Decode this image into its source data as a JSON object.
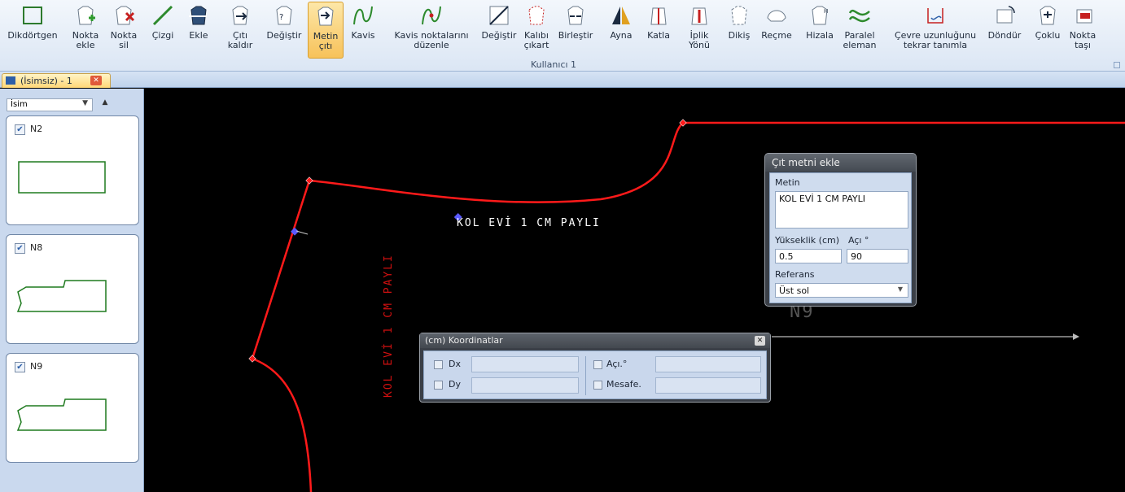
{
  "ribbon": {
    "tools": [
      {
        "id": "dikdortgen",
        "label": "Dikdörtgen",
        "icon": "rectangle-icon"
      },
      {
        "id": "nokta-ekle",
        "label": "Nokta ekle",
        "icon": "add-point-icon"
      },
      {
        "id": "nokta-sil",
        "label": "Nokta sil",
        "icon": "delete-point-icon"
      },
      {
        "id": "cizgi",
        "label": "Çizgi",
        "icon": "line-icon"
      },
      {
        "id": "ekle",
        "label": "Ekle",
        "icon": "insert-icon"
      },
      {
        "id": "citi-kaldir",
        "label": "Çıtı kaldır",
        "icon": "remove-notch-icon"
      },
      {
        "id": "degistir-1",
        "label": "Değiştir",
        "icon": "change-icon"
      },
      {
        "id": "metin-citi",
        "label": "Metin çıtı",
        "icon": "text-notch-icon",
        "active": true
      },
      {
        "id": "kavis",
        "label": "Kavis",
        "icon": "curve-icon"
      },
      {
        "id": "kavis-noktalari",
        "label": "Kavis noktalarını düzenle",
        "icon": "edit-curve-points-icon"
      },
      {
        "id": "degistir-2",
        "label": "Değiştir",
        "icon": "replace-icon"
      },
      {
        "id": "kalibi-cikart",
        "label": "Kalıbı çıkart",
        "icon": "extract-pattern-icon"
      },
      {
        "id": "birlestir",
        "label": "Birleştir",
        "icon": "merge-icon"
      },
      {
        "id": "ayna",
        "label": "Ayna",
        "icon": "mirror-icon"
      },
      {
        "id": "katla",
        "label": "Katla",
        "icon": "fold-icon"
      },
      {
        "id": "iplik-yonu",
        "label": "İplik Yönü",
        "icon": "grain-line-icon"
      },
      {
        "id": "dikis",
        "label": "Dikiş",
        "icon": "seam-icon"
      },
      {
        "id": "recme",
        "label": "Reçme",
        "icon": "gather-icon"
      },
      {
        "id": "hizala",
        "label": "Hizala",
        "icon": "align-icon"
      },
      {
        "id": "paralel-eleman",
        "label": "Paralel eleman",
        "icon": "parallel-icon"
      },
      {
        "id": "cevre-uzunlugu",
        "label": "Çevre uzunluğunu tekrar tanımla",
        "icon": "perimeter-icon"
      },
      {
        "id": "dondur",
        "label": "Döndür",
        "icon": "rotate-icon"
      },
      {
        "id": "coklu",
        "label": "Çoklu",
        "icon": "multiple-icon"
      },
      {
        "id": "nokta-tasi",
        "label": "Nokta taşı",
        "icon": "move-point-icon"
      }
    ],
    "group_label": "Kullanıcı 1"
  },
  "document_tab": {
    "label": "(İsimsiz) - 1",
    "close": "✕"
  },
  "sidebar": {
    "sort_label": "İsim",
    "pieces": [
      {
        "name": "N2",
        "checked": true
      },
      {
        "name": "N8",
        "checked": true
      },
      {
        "name": "N9",
        "checked": true
      }
    ]
  },
  "canvas": {
    "text_horizontal": "KOL EVİ 1 CM PAYLI",
    "text_vertical": "KOL EVİ 1 CM PAYLI",
    "ghost_label": "N9"
  },
  "notch_text_dialog": {
    "title": "Çıt metni ekle",
    "text_label": "Metin",
    "text_value": "KOL EVİ 1 CM PAYLI",
    "height_label": "Yükseklik (cm)",
    "height_value": "0.5",
    "angle_label": "Açı °",
    "angle_value": "90",
    "reference_label": "Referans",
    "reference_value": "Üst sol"
  },
  "coordinates_dialog": {
    "title": "(cm) Koordinatlar",
    "dx_label": "Dx",
    "dy_label": "Dy",
    "angle_label": "Açı.°",
    "distance_label": "Mesafe."
  },
  "colors": {
    "pattern_line": "#ff1a1a",
    "accent": "#f7c25a",
    "piece_outline": "#1f7a1f"
  }
}
